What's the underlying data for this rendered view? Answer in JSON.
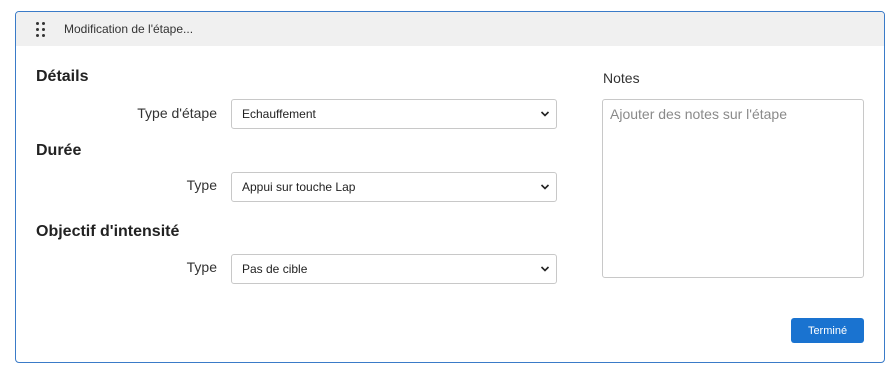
{
  "header": {
    "title": "Modification de l'étape..."
  },
  "details": {
    "title": "Détails",
    "step_type_label": "Type d'étape",
    "step_type_value": "Echauffement"
  },
  "duration": {
    "title": "Durée",
    "type_label": "Type",
    "type_value": "Appui sur touche Lap"
  },
  "intensity": {
    "title": "Objectif d'intensité",
    "type_label": "Type",
    "type_value": "Pas de cible"
  },
  "notes": {
    "label": "Notes",
    "placeholder": "Ajouter des notes sur l'étape",
    "value": ""
  },
  "actions": {
    "done_label": "Terminé"
  },
  "colors": {
    "accent": "#1a73d0",
    "border": "#3a7bc8",
    "header_bg": "#f0f0f0"
  },
  "icons": {
    "drag": "drag-handle-icon",
    "chevron": "chevron-down-icon"
  }
}
